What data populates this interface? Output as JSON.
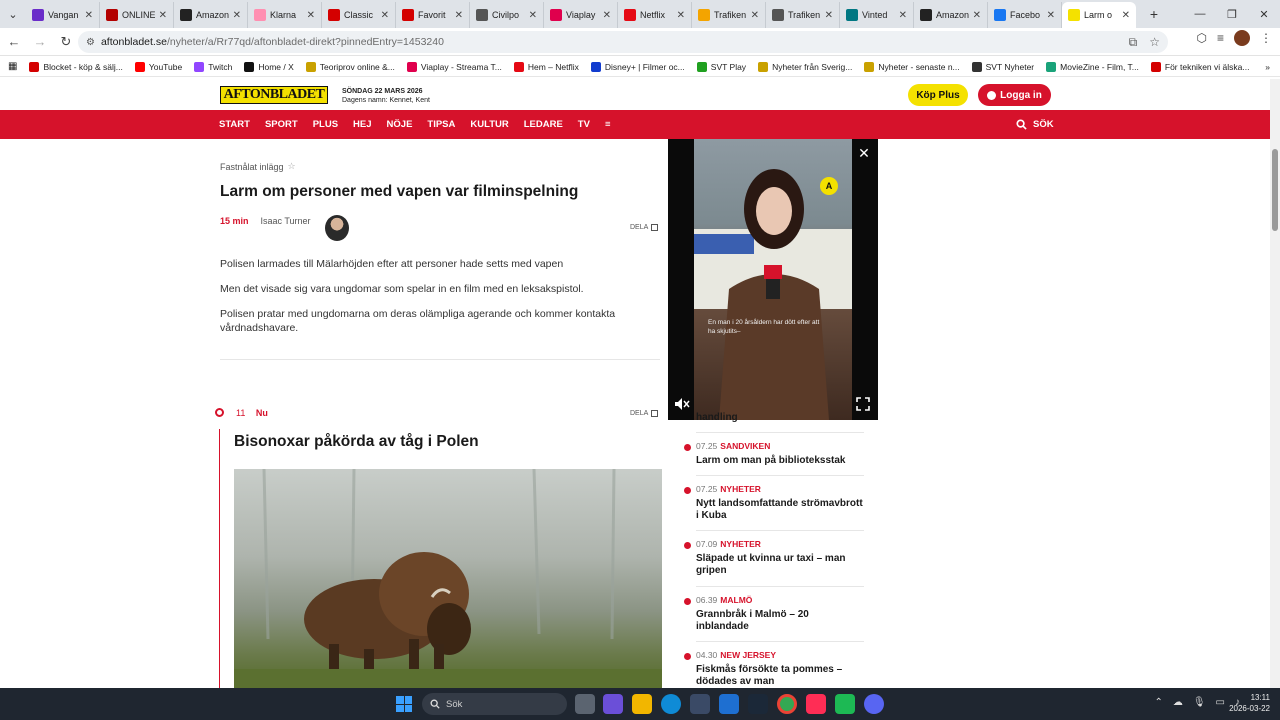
{
  "browser": {
    "tabs": [
      {
        "label": "Vangan",
        "color": "#6a2cc9"
      },
      {
        "label": "ONLINE",
        "color": "#b30000"
      },
      {
        "label": "Amazon",
        "color": "#222222"
      },
      {
        "label": "Klarna",
        "color": "#ff8fb1"
      },
      {
        "label": "Classic",
        "color": "#d40000"
      },
      {
        "label": "Favorit",
        "color": "#d40000"
      },
      {
        "label": "Civilpo",
        "color": "#555555"
      },
      {
        "label": "Viaplay",
        "color": "#e0004d"
      },
      {
        "label": "Netflix",
        "color": "#e50914"
      },
      {
        "label": "Trafiken",
        "color": "#f4a400"
      },
      {
        "label": "Trafiken",
        "color": "#555555"
      },
      {
        "label": "Vinted",
        "color": "#007782"
      },
      {
        "label": "Amazon",
        "color": "#222222"
      },
      {
        "label": "Facebo",
        "color": "#1877f2"
      },
      {
        "label": "Larm o",
        "color": "#f4e100"
      }
    ],
    "url_host": "aftonbladet.se",
    "url_path": "/nyheter/a/Rr77qd/aftonbladet-direkt?pinnedEntry=1453240",
    "bookmarks": [
      {
        "label": "Blocket - köp & sälj...",
        "color": "#d40000"
      },
      {
        "label": "YouTube",
        "color": "#ff0000"
      },
      {
        "label": "Twitch",
        "color": "#9146ff"
      },
      {
        "label": "Home / X",
        "color": "#111111"
      },
      {
        "label": "Teoriprov online &...",
        "color": "#c9a100"
      },
      {
        "label": "Viaplay - Streama T...",
        "color": "#e0004d"
      },
      {
        "label": "Hem – Netflix",
        "color": "#e50914"
      },
      {
        "label": "Disney+ | Filmer oc...",
        "color": "#113ccf"
      },
      {
        "label": "SVT Play",
        "color": "#20a020"
      },
      {
        "label": "Nyheter från Sverig...",
        "color": "#c9a100"
      },
      {
        "label": "Nyheter - senaste n...",
        "color": "#c9a100"
      },
      {
        "label": "SVT Nyheter",
        "color": "#333333"
      },
      {
        "label": "MovieZine - Film, T...",
        "color": "#1aa37a"
      },
      {
        "label": "För tekniken vi älska...",
        "color": "#d40000"
      }
    ]
  },
  "site": {
    "logo": "AFTONBLADET",
    "date_line": "SÖNDAG 22 MARS 2026",
    "names_line": "Dagens namn: Kennet, Kent",
    "kop_plus": "Köp Plus",
    "logga_in": "Logga in",
    "menu": [
      "START",
      "SPORT",
      "PLUS",
      "HEJ",
      "NÖJE",
      "TIPSA",
      "KULTUR",
      "LEDARE",
      "TV"
    ],
    "search": "SÖK"
  },
  "entry1": {
    "pinned_label": "Fastnålat inlägg",
    "title": "Larm om personer med vapen var filminspelning",
    "time": "15 min",
    "author": "Isaac Turner",
    "share": "DELA",
    "paragraphs": [
      "Polisen larmades till Mälarhöjden efter att personer hade setts med vapen",
      "Men det visade sig vara ungdomar som spelar in en film med en leksakspistol.",
      "Polisen pratar med ungdomarna om deras olämpliga agerande och kommer kontakta vårdnadshavare."
    ]
  },
  "entry2": {
    "time": "11",
    "status": "Nu",
    "share": "DELA",
    "title": "Bisonoxar påkörda av tåg i Polen"
  },
  "video": {
    "caption": "En man i 20 årsåldern har dött efter att ha skjutits–"
  },
  "sidebar": {
    "partial_title": "handling",
    "items": [
      {
        "time": "07.25",
        "category": "SANDVIKEN",
        "title": "Larm om man på biblioteksstak"
      },
      {
        "time": "07.25",
        "category": "NYHETER",
        "title": "Nytt landsomfattande strömavbrott i Kuba"
      },
      {
        "time": "07.09",
        "category": "NYHETER",
        "title": "Släpade ut kvinna ur taxi – man gripen"
      },
      {
        "time": "06.39",
        "category": "MALMÖ",
        "title": "Grannbråk i Malmö – 20 inblandade"
      },
      {
        "time": "04.30",
        "category": "NEW JERSEY",
        "title": "Fiskmås försökte ta pommes – dödades av man"
      }
    ]
  },
  "taskbar": {
    "search": "Sök",
    "time": "13:11",
    "date": "2026-03-22"
  }
}
